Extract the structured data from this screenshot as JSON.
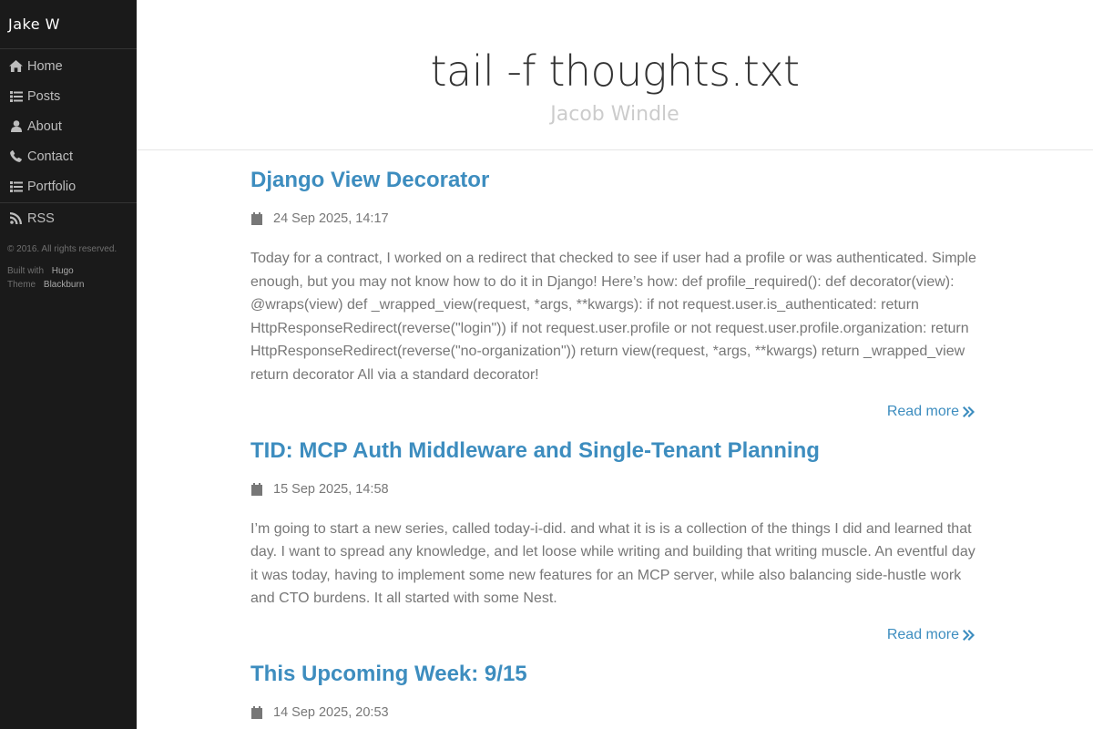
{
  "brand": "Jake W",
  "nav": [
    {
      "label": "Home",
      "icon": "home-icon"
    },
    {
      "label": "Posts",
      "icon": "list-icon"
    },
    {
      "label": "About",
      "icon": "user-icon"
    },
    {
      "label": "Contact",
      "icon": "phone-icon"
    },
    {
      "label": "Portfolio",
      "icon": "list-icon"
    }
  ],
  "rss": {
    "label": "RSS",
    "icon": "rss-icon"
  },
  "footer": {
    "copyright": "© 2016. All rights reserved.",
    "built_with_label": "Built with",
    "built_with_link": "Hugo",
    "theme_label": "Theme",
    "theme_link": "Blackburn"
  },
  "header": {
    "title": "tail -f thoughts.txt",
    "subtitle": "Jacob Windle"
  },
  "posts": [
    {
      "title": "Django View Decorator",
      "date": "24 Sep 2025, 14:17",
      "summary": "Today for a contract, I worked on a redirect that checked to see if user had a profile or was authenticated. Simple enough, but you may not know how to do it in Django! Here’s how: def profile_required(): def decorator(view): @wraps(view) def _wrapped_view(request, *args, **kwargs): if not request.user.is_authenticated: return HttpResponseRedirect(reverse(\"login\")) if not request.user.profile or not request.user.profile.organization: return HttpResponseRedirect(reverse(\"no-organization\")) return view(request, *args, **kwargs) return _wrapped_view return decorator All via a standard decorator!",
      "read_more": "Read more"
    },
    {
      "title": "TID: MCP Auth Middleware and Single-Tenant Planning",
      "date": "15 Sep 2025, 14:58",
      "summary": "I’m going to start a new series, called today-i-did. and what it is is a collection of the things I did and learned that day. I want to spread any knowledge, and let loose while writing and building that writing muscle. An eventful day it was today, having to implement some new features for an MCP server, while also balancing side-hustle work and CTO burdens. It all started with some Nest.",
      "read_more": "Read more"
    },
    {
      "title": "This Upcoming Week: 9/15",
      "date": "14 Sep 2025, 20:53"
    }
  ],
  "colors": {
    "sidebar_bg": "#1a1a1a",
    "link": "#3d8dbf",
    "text": "#777777",
    "title": "#333333",
    "subtitle": "#cccccc"
  }
}
